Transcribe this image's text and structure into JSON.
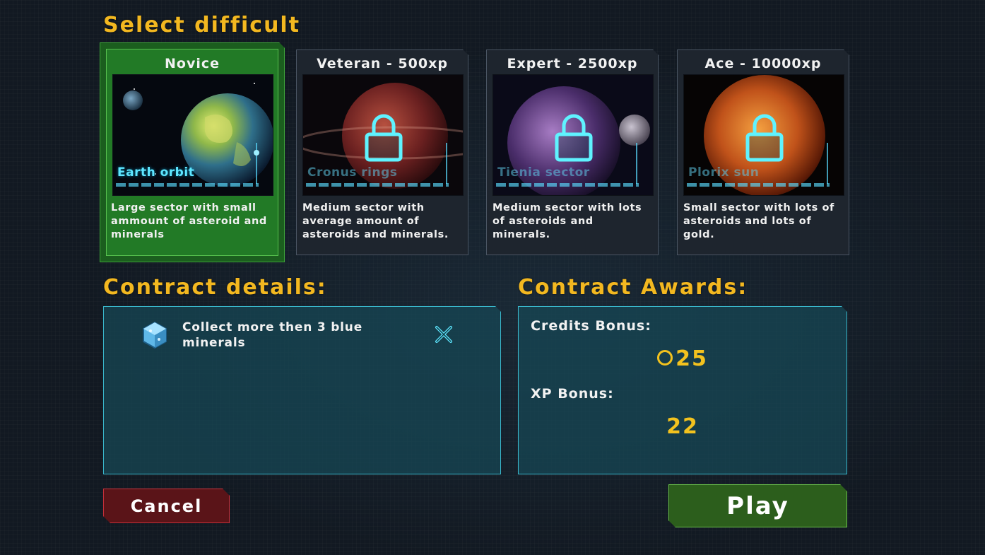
{
  "title": "Select difficult",
  "difficulties": [
    {
      "title": "Novice",
      "location": "Earth orbit",
      "description": "Large sector with small ammount of asteroid and minerals",
      "selected": true,
      "locked": false
    },
    {
      "title": "Veteran - 500xp",
      "location": "Cronus rings",
      "description": "Medium sector with average amount of asteroids and minerals.",
      "selected": false,
      "locked": true
    },
    {
      "title": "Expert - 2500xp",
      "location": "Tienia sector",
      "description": "Medium sector with lots of asteroids and minerals.",
      "selected": false,
      "locked": true
    },
    {
      "title": "Ace - 10000xp",
      "location": "Plorix sun",
      "description": "Small sector with lots of asteroids and lots of gold.",
      "selected": false,
      "locked": true
    }
  ],
  "contract_details": {
    "heading": "Contract details:",
    "objectives": [
      {
        "icon": "blue-mineral-icon",
        "text": "Collect more then 3 blue minerals",
        "status_icon": "close-icon"
      }
    ]
  },
  "contract_awards": {
    "heading": "Contract Awards:",
    "credits_label": "Credits Bonus:",
    "credits_value": "25",
    "credits_icon": "credit-coin-icon",
    "xp_label": "XP Bonus:",
    "xp_value": "22"
  },
  "buttons": {
    "cancel": "Cancel",
    "play": "Play"
  },
  "colors": {
    "heading": "#f3b820",
    "selected_card": "#227a26",
    "panel_border": "#3ab8cc",
    "hud_cyan": "#5fe6ff",
    "cancel": "#5a1418",
    "play": "#2c5e1c",
    "award_value": "#f3c21e"
  }
}
